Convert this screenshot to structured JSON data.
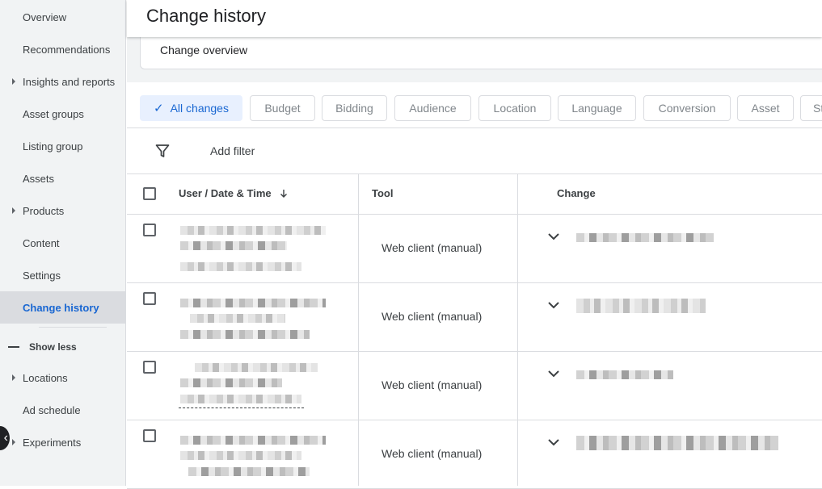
{
  "sidebar": {
    "items": [
      {
        "label": "Overview",
        "expandable": false,
        "active": false
      },
      {
        "label": "Recommendations",
        "expandable": false,
        "active": false
      },
      {
        "label": "Insights and reports",
        "expandable": true,
        "active": false
      },
      {
        "label": "Asset groups",
        "expandable": false,
        "active": false
      },
      {
        "label": "Listing group",
        "expandable": false,
        "active": false
      },
      {
        "label": "Assets",
        "expandable": false,
        "active": false
      },
      {
        "label": "Products",
        "expandable": true,
        "active": false
      },
      {
        "label": "Content",
        "expandable": false,
        "active": false
      },
      {
        "label": "Settings",
        "expandable": false,
        "active": false
      },
      {
        "label": "Change history",
        "expandable": false,
        "active": true
      }
    ],
    "show_less_label": "Show less",
    "more_items": [
      {
        "label": "Locations",
        "expandable": true
      },
      {
        "label": "Ad schedule",
        "expandable": false
      },
      {
        "label": "Experiments",
        "expandable": true
      }
    ],
    "collapse_icon": "chevron-left-icon"
  },
  "header": {
    "title": "Change history"
  },
  "overview": {
    "label": "Change overview"
  },
  "chips": [
    {
      "label": "All changes",
      "selected": true
    },
    {
      "label": "Budget",
      "selected": false
    },
    {
      "label": "Bidding",
      "selected": false
    },
    {
      "label": "Audience",
      "selected": false
    },
    {
      "label": "Location",
      "selected": false
    },
    {
      "label": "Language",
      "selected": false
    },
    {
      "label": "Conversion",
      "selected": false
    },
    {
      "label": "Asset",
      "selected": false
    },
    {
      "label": "St",
      "selected": false
    }
  ],
  "filter": {
    "add_label": "Add filter",
    "icon": "filter-icon"
  },
  "table": {
    "headers": {
      "user": "User / Date & Time",
      "sort_icon": "arrow-down-icon",
      "tool": "Tool",
      "change": "Change"
    },
    "rows": [
      {
        "tool": "Web client (manual)"
      },
      {
        "tool": "Web client (manual)"
      },
      {
        "tool": "Web client (manual)"
      },
      {
        "tool": "Web client (manual)"
      }
    ]
  },
  "colors": {
    "accent": "#1967d2",
    "active_bg": "#dadce0",
    "chip_selected_bg": "#e8f0fe"
  }
}
